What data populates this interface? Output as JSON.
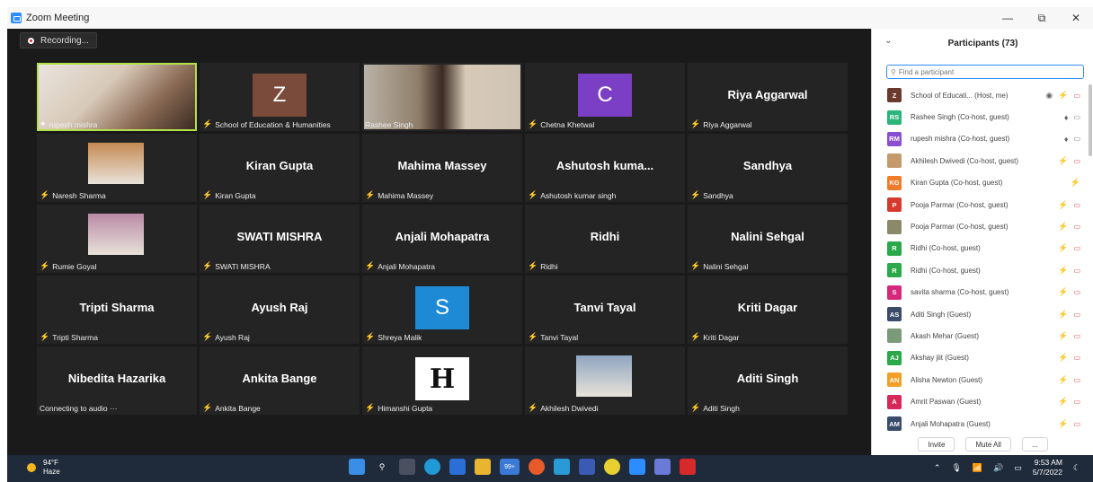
{
  "window": {
    "title": "Zoom Meeting",
    "minimize": "—",
    "restore": "⧉",
    "close": "✕"
  },
  "recording": {
    "label": "Recording..."
  },
  "tiles": [
    {
      "label": "rupesh mishra",
      "mic": "on",
      "kind": "video"
    },
    {
      "label": "School of Education & Humanities",
      "mic": "off",
      "kind": "avatar",
      "avatar": "Z",
      "avatar_color": "#7a4a3a"
    },
    {
      "label": "Rashee Singh",
      "mic": "none",
      "kind": "video2"
    },
    {
      "label": "Chetna Khetwal",
      "mic": "off",
      "kind": "avatar",
      "avatar": "C",
      "avatar_color": "#7b3fc6"
    },
    {
      "label": "Riya Aggarwal",
      "mic": "off",
      "kind": "name",
      "big": "Riya Aggarwal"
    },
    {
      "label": "Naresh Sharma",
      "mic": "off",
      "kind": "photo",
      "photo_color": "#c58a53"
    },
    {
      "label": "Kiran Gupta",
      "mic": "off",
      "kind": "name",
      "big": "Kiran Gupta"
    },
    {
      "label": "Mahima Massey",
      "mic": "off",
      "kind": "name",
      "big": "Mahima Massey"
    },
    {
      "label": "Ashutosh kumar singh",
      "mic": "off",
      "kind": "name",
      "big": "Ashutosh  kuma..."
    },
    {
      "label": "Sandhya",
      "mic": "off",
      "kind": "name",
      "big": "Sandhya"
    },
    {
      "label": "Rumie Goyal",
      "mic": "off",
      "kind": "photo",
      "photo_color": "#b98aa5"
    },
    {
      "label": "SWATI MISHRA",
      "mic": "off",
      "kind": "name",
      "big": "SWATI MISHRA"
    },
    {
      "label": "Anjali Mohapatra",
      "mic": "off",
      "kind": "name",
      "big": "Anjali Mohapatra"
    },
    {
      "label": "Ridhi",
      "mic": "off",
      "kind": "name",
      "big": "Ridhi"
    },
    {
      "label": "Nalini Sehgal",
      "mic": "off",
      "kind": "name",
      "big": "Nalini Sehgal"
    },
    {
      "label": "Tripti Sharma",
      "mic": "off",
      "kind": "name",
      "big": "Tripti Sharma"
    },
    {
      "label": "Ayush Raj",
      "mic": "off",
      "kind": "name",
      "big": "Ayush Raj"
    },
    {
      "label": "Shreya Malik",
      "mic": "off",
      "kind": "avatar",
      "avatar": "S",
      "avatar_color": "#1e8ad6"
    },
    {
      "label": "Tanvi Tayal",
      "mic": "off",
      "kind": "name",
      "big": "Tanvi Tayal"
    },
    {
      "label": "Kriti Dagar",
      "mic": "off",
      "kind": "name",
      "big": "Kriti Dagar"
    },
    {
      "label": "Connecting to audio ···",
      "mic": "none",
      "kind": "name",
      "big": "Nibedita Hazarika"
    },
    {
      "label": "Ankita Bange",
      "mic": "off",
      "kind": "name",
      "big": "Ankita Bange"
    },
    {
      "label": "Himanshi Gupta",
      "mic": "off",
      "kind": "logo",
      "avatar": "H"
    },
    {
      "label": "Akhilesh Dwivedi",
      "mic": "off",
      "kind": "photo",
      "photo_color": "#8fa6c0"
    },
    {
      "label": "Aditi Singh",
      "mic": "off",
      "kind": "name",
      "big": "Aditi Singh"
    }
  ],
  "participants": {
    "title": "Participants (73)",
    "search_placeholder": "Find a participant",
    "list": [
      {
        "initials": "Z",
        "color": "#6b3a2e",
        "name": "School of Educati... (Host, me)",
        "status": "host"
      },
      {
        "initials": "RS",
        "color": "#2bb57a",
        "name": "Rashee Singh (Co-host, guest)",
        "status": "mic"
      },
      {
        "initials": "RM",
        "color": "#8a4fd1",
        "name": "rupesh mishra (Co-host, guest)",
        "status": "mic"
      },
      {
        "initials": "",
        "color": "#c49a6c",
        "name": "Akhilesh Dwivedi (Co-host, guest)",
        "status": "off"
      },
      {
        "initials": "KG",
        "color": "#f07b2a",
        "name": "Kiran Gupta (Co-host, guest)",
        "status": "miconly"
      },
      {
        "initials": "P",
        "color": "#d63a2f",
        "name": "Pooja Parmar (Co-host, guest)",
        "status": "off"
      },
      {
        "initials": "",
        "color": "#8a8a6a",
        "name": "Pooja Parmar (Co-host, guest)",
        "status": "off"
      },
      {
        "initials": "R",
        "color": "#2aa84a",
        "name": "Ridhi (Co-host, guest)",
        "status": "off"
      },
      {
        "initials": "R",
        "color": "#2aa84a",
        "name": "Ridhi (Co-host, guest)",
        "status": "off"
      },
      {
        "initials": "S",
        "color": "#d6287a",
        "name": "savita sharma (Co-host, guest)",
        "status": "off"
      },
      {
        "initials": "AS",
        "color": "#3a4a6a",
        "name": "Aditi Singh (Guest)",
        "status": "off"
      },
      {
        "initials": "",
        "color": "#7a9a7a",
        "name": "Akash Mehar (Guest)",
        "status": "off"
      },
      {
        "initials": "AJ",
        "color": "#2aa84a",
        "name": "Akshay jiit (Guest)",
        "status": "off"
      },
      {
        "initials": "AN",
        "color": "#f0a028",
        "name": "Alisha Newton (Guest)",
        "status": "off"
      },
      {
        "initials": "A",
        "color": "#d6285a",
        "name": "Amrit Paswan (Guest)",
        "status": "off"
      },
      {
        "initials": "AM",
        "color": "#3a4a6a",
        "name": "Anjali Mohapatra (Guest)",
        "status": "off"
      }
    ],
    "invite_label": "Invite",
    "mute_all_label": "Mute All",
    "more_label": "..."
  },
  "taskbar": {
    "temp": "94°F",
    "condition": "Haze",
    "badge": "99+",
    "time": "9:53 AM",
    "date": "5/7/2022"
  }
}
